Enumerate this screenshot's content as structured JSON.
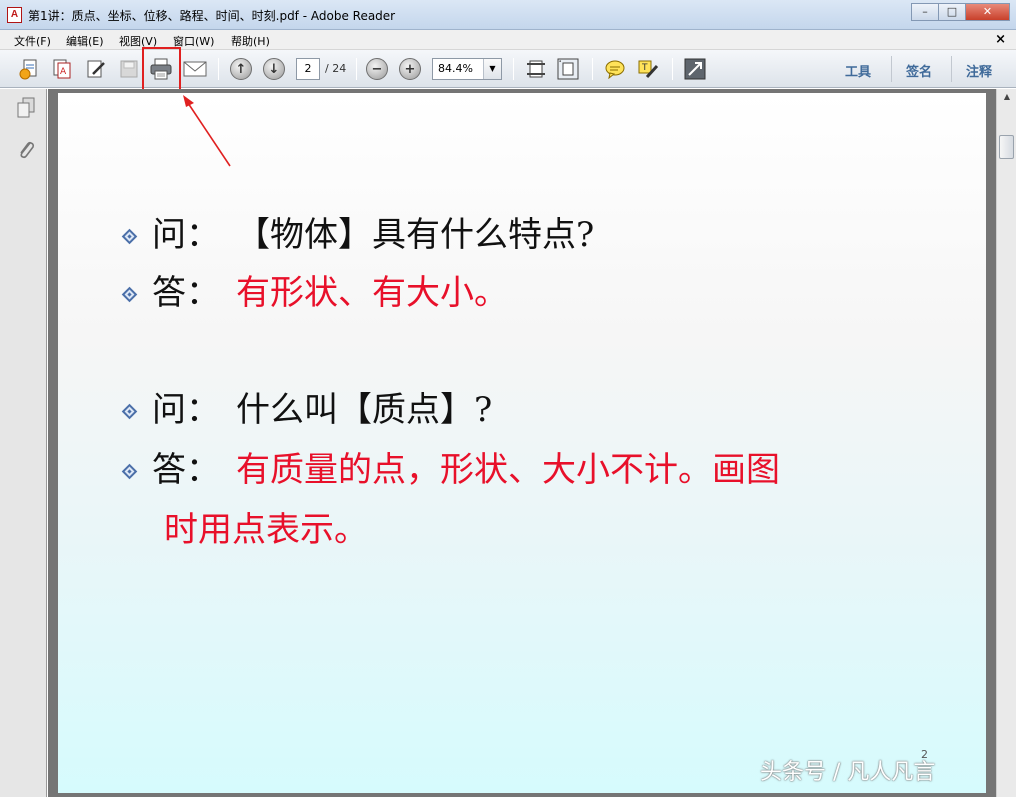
{
  "window": {
    "title": "第1讲：质点、坐标、位移、路程、时间、时刻.pdf - Adobe Reader",
    "icon_glyph": "A",
    "minimize": "–",
    "maximize": "□",
    "close": "✕"
  },
  "menu": {
    "items": [
      "文件(F)",
      "编辑(E)",
      "视图(V)",
      "窗口(W)",
      "帮助(H)"
    ],
    "close_glyph": "×"
  },
  "toolbar": {
    "icons": [
      "create-icon",
      "combine-icon",
      "edit-icon",
      "save-icon",
      "print-icon",
      "email-icon",
      "prev-page-icon",
      "next-page-icon",
      "zoom-out-icon",
      "zoom-in-icon",
      "fit-width-icon",
      "fit-page-icon",
      "comment-icon",
      "highlight-icon",
      "fullscreen-icon"
    ],
    "page_current": "2",
    "page_total": "/ 24",
    "zoom": "84.4%",
    "right_tools": [
      "工具",
      "签名",
      "注释"
    ]
  },
  "annotation": {
    "highlighted_tool": "print-icon",
    "color": "#e02020"
  },
  "document": {
    "lines": [
      {
        "q": "问：",
        "a": "【物体】具有什么特点?",
        "a_color": "black"
      },
      {
        "q": "答：",
        "a": "有形状、有大小。",
        "a_color": "red"
      },
      {
        "q": "问：",
        "a": "什么叫【质点】?",
        "a_color": "black"
      },
      {
        "q": "答：",
        "a": "有质量的点，形状、大小不计。画图",
        "a_color": "red"
      }
    ],
    "continuation": "时用点表示。",
    "page_number": "2",
    "watermark": "头条号 / 凡人凡言"
  }
}
